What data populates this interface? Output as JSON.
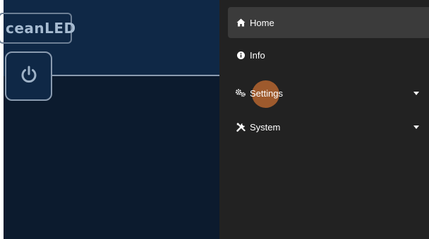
{
  "header": {
    "logo_text": "ceanLED"
  },
  "controls": {
    "power_icon": "power-icon"
  },
  "menu": {
    "items": [
      {
        "label": "Home",
        "icon": "home-icon",
        "active": true,
        "has_caret": false
      },
      {
        "label": "Info",
        "icon": "info-icon",
        "active": false,
        "has_caret": false
      },
      {
        "label": "Settings",
        "icon": "gears-icon",
        "active": false,
        "has_caret": true
      },
      {
        "label": "System",
        "icon": "tools-icon",
        "active": false,
        "has_caret": true
      }
    ]
  },
  "colors": {
    "panel_bg": "#0c1b2e",
    "header_bg": "#0f2846",
    "menu_bg": "#222222",
    "menu_active_bg": "#3b3b3b",
    "ripple": "#c86e32"
  }
}
